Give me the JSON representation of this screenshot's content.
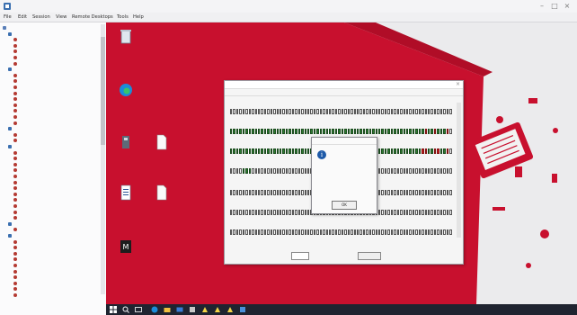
{
  "window": {
    "title": "",
    "controls": [
      "minimize-icon",
      "maximize-icon",
      "close-icon"
    ]
  },
  "menu": {
    "items": [
      "File",
      "Edit",
      "Session",
      "View",
      "Remote Desktops",
      "Tools",
      "Help"
    ]
  },
  "tree": {
    "rows": [
      {
        "label": "",
        "kind": "root",
        "level": 0
      },
      {
        "label": "",
        "kind": "group",
        "level": 1
      },
      {
        "label": "",
        "kind": "device",
        "level": 2
      },
      {
        "label": "",
        "kind": "device",
        "level": 2
      },
      {
        "label": "",
        "kind": "device",
        "level": 2
      },
      {
        "label": "",
        "kind": "device",
        "level": 2
      },
      {
        "label": "",
        "kind": "device",
        "level": 2
      },
      {
        "label": "",
        "kind": "group",
        "level": 1
      },
      {
        "label": "",
        "kind": "device",
        "level": 2
      },
      {
        "label": "",
        "kind": "device",
        "level": 2
      },
      {
        "label": "",
        "kind": "device",
        "level": 2
      },
      {
        "label": "",
        "kind": "device",
        "level": 2
      },
      {
        "label": "",
        "kind": "device",
        "level": 2
      },
      {
        "label": "",
        "kind": "device",
        "level": 2
      },
      {
        "label": "",
        "kind": "device",
        "level": 2
      },
      {
        "label": "",
        "kind": "device",
        "level": 2
      },
      {
        "label": "",
        "kind": "device",
        "level": 2
      },
      {
        "label": "",
        "kind": "group",
        "level": 1
      },
      {
        "label": "",
        "kind": "device",
        "level": 2
      },
      {
        "label": "",
        "kind": "device",
        "level": 2
      },
      {
        "label": "",
        "kind": "group",
        "level": 1
      },
      {
        "label": "",
        "kind": "device",
        "level": 2
      },
      {
        "label": "",
        "kind": "device",
        "level": 2
      },
      {
        "label": "",
        "kind": "device",
        "level": 2
      },
      {
        "label": "",
        "kind": "device",
        "level": 2
      },
      {
        "label": "",
        "kind": "device",
        "level": 2
      },
      {
        "label": "",
        "kind": "device",
        "level": 2
      },
      {
        "label": "",
        "kind": "device",
        "level": 2
      },
      {
        "label": "",
        "kind": "device",
        "level": 2
      },
      {
        "label": "",
        "kind": "device",
        "level": 2
      },
      {
        "label": "",
        "kind": "device",
        "level": 2
      },
      {
        "label": "",
        "kind": "device",
        "level": 2
      },
      {
        "label": "",
        "kind": "device",
        "level": 2
      },
      {
        "label": "",
        "kind": "group",
        "level": 1
      },
      {
        "label": "",
        "kind": "device",
        "level": 2
      },
      {
        "label": "",
        "kind": "group",
        "level": 1
      },
      {
        "label": "",
        "kind": "device",
        "level": 2
      },
      {
        "label": "",
        "kind": "device",
        "level": 2
      },
      {
        "label": "",
        "kind": "device",
        "level": 2
      },
      {
        "label": "",
        "kind": "device",
        "level": 2
      },
      {
        "label": "",
        "kind": "device",
        "level": 2
      },
      {
        "label": "",
        "kind": "device",
        "level": 2
      },
      {
        "label": "",
        "kind": "device",
        "level": 2
      },
      {
        "label": "",
        "kind": "device",
        "level": 2
      },
      {
        "label": "",
        "kind": "device",
        "level": 2
      },
      {
        "label": "",
        "kind": "device",
        "level": 2
      }
    ]
  },
  "desktop": {
    "accent": "#c8102e",
    "icons": [
      {
        "name": "recycle-bin-icon",
        "label": ""
      },
      {
        "name": "edge-browser-icon",
        "label": ""
      },
      {
        "name": "app-shortcut-icon",
        "label": ""
      },
      {
        "name": "document-file-icon",
        "label": ""
      },
      {
        "name": "text-document-icon",
        "label": ""
      },
      {
        "name": "blank-file-icon",
        "label": ""
      },
      {
        "name": "app-launcher-icon",
        "label": ""
      }
    ]
  },
  "app": {
    "title": "",
    "menu": [
      "",
      "",
      ""
    ],
    "sections": [
      {
        "label": "",
        "on": [],
        "red": []
      },
      {
        "label": "",
        "on": [
          0,
          1,
          2,
          3,
          4,
          5,
          6,
          7,
          8,
          9,
          10,
          11,
          12,
          13,
          14,
          15,
          16,
          17,
          18,
          19,
          20,
          21,
          22,
          23,
          24,
          25,
          26,
          27,
          28,
          29,
          30,
          31,
          32,
          33,
          34,
          35,
          36,
          37,
          38,
          39,
          40,
          41,
          42,
          43,
          44,
          45,
          46,
          47,
          48,
          49,
          50,
          51,
          52,
          53,
          54,
          55,
          56,
          57,
          58,
          59,
          60,
          61,
          62,
          63,
          64,
          65,
          66,
          67,
          68,
          69,
          70
        ],
        "red": [
          63,
          66,
          70
        ]
      },
      {
        "label": "",
        "on": [
          0,
          1,
          2,
          3,
          4,
          5,
          6,
          7,
          8,
          9,
          10,
          11,
          12,
          13,
          14,
          15,
          16,
          17,
          18,
          19,
          20,
          21,
          22,
          23,
          24,
          25,
          26,
          27,
          28,
          29,
          30,
          31,
          32,
          33,
          34,
          35,
          36,
          37,
          38,
          39,
          40,
          41,
          42,
          43,
          44,
          45,
          46,
          47,
          48,
          49,
          50,
          51,
          52,
          53,
          54,
          55,
          56,
          57,
          58,
          59,
          60,
          61,
          62,
          63,
          64,
          65,
          66,
          67,
          68,
          69,
          70
        ],
        "red": [
          62,
          63,
          66,
          67,
          70
        ]
      },
      {
        "label": "",
        "on": [
          4,
          5,
          6
        ],
        "red": []
      },
      {
        "label": "",
        "on": [],
        "red": []
      },
      {
        "label": "",
        "on": [],
        "red": []
      },
      {
        "label": "",
        "on": [],
        "red": []
      }
    ],
    "bottom": {
      "label_a": "",
      "label_b": "",
      "button": ""
    }
  },
  "dialog": {
    "title": "",
    "lines": [
      "",
      "",
      "",
      "",
      ""
    ],
    "ok_label": "OK"
  },
  "taskbar": {
    "clock": "",
    "color": "#1f2430"
  }
}
